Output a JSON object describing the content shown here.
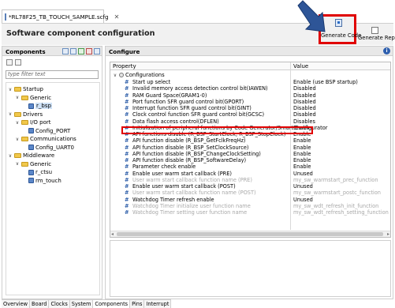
{
  "file_tab": {
    "label": "*RL78F25_TB_TOUCH_SAMPLE.scfg",
    "close": "✕"
  },
  "header": {
    "title": "Software component configuration"
  },
  "buttons": {
    "generate_code": "Generate Code",
    "generate_report": "Generate Report"
  },
  "components_panel": {
    "title": "Components",
    "filter_placeholder": "type filter text",
    "tree": [
      {
        "label": "Startup",
        "kind": "folder",
        "depth": 0,
        "expanded": true
      },
      {
        "label": "Generic",
        "kind": "folder",
        "depth": 1,
        "expanded": true
      },
      {
        "label": "r_bsp",
        "kind": "component",
        "depth": 2,
        "selected": true
      },
      {
        "label": "Drivers",
        "kind": "folder",
        "depth": 0,
        "expanded": true
      },
      {
        "label": "I/O port",
        "kind": "folder",
        "depth": 1,
        "expanded": true
      },
      {
        "label": "Config_PORT",
        "kind": "component",
        "depth": 2
      },
      {
        "label": "Communications",
        "kind": "folder",
        "depth": 1,
        "expanded": true
      },
      {
        "label": "Config_UART0",
        "kind": "component",
        "depth": 2
      },
      {
        "label": "Middleware",
        "kind": "folder",
        "depth": 0,
        "expanded": true
      },
      {
        "label": "Generic",
        "kind": "folder",
        "depth": 1,
        "expanded": true
      },
      {
        "label": "r_ctsu",
        "kind": "component",
        "depth": 2
      },
      {
        "label": "rm_touch",
        "kind": "component",
        "depth": 2
      }
    ]
  },
  "configure_panel": {
    "title": "Configure",
    "info_icon": "i",
    "col_property": "Property",
    "col_value": "Value",
    "root_label": "Configurations",
    "rows": [
      {
        "property": "Start up select",
        "value": "Enable (use BSP startup)",
        "enabled": true
      },
      {
        "property": "Invalid memory access detection control bit(IAWEN)",
        "value": "Disabled",
        "enabled": true
      },
      {
        "property": "RAM Guard Space(GRAM1-0)",
        "value": "Disabled",
        "enabled": true
      },
      {
        "property": "Port function SFR guard control bit(GPORT)",
        "value": "Disabled",
        "enabled": true
      },
      {
        "property": "Interrupt function SFR guard control bit(GINT)",
        "value": "Disabled",
        "enabled": true
      },
      {
        "property": "Clock control function SFR guard control bit(GCSC)",
        "value": "Disabled",
        "enabled": true
      },
      {
        "property": "Data flash access control(DFLEN)",
        "value": "Disables",
        "enabled": true
      },
      {
        "property": "Initialization of peripheral functions by Code Generator/Smart Configurator",
        "value": "Enable",
        "enabled": true,
        "highlighted": true
      },
      {
        "property": "API functions disable (R_BSP_StartClock, R_BSP_StopClock)",
        "value": "Enable",
        "enabled": true
      },
      {
        "property": "API function disable (R_BSP_GetFclkFreqHz)",
        "value": "Enable",
        "enabled": true
      },
      {
        "property": "API function disable (R_BSP_SetClockSource)",
        "value": "Enable",
        "enabled": true
      },
      {
        "property": "API function disable (R_BSP_ChangeClockSetting)",
        "value": "Enable",
        "enabled": true
      },
      {
        "property": "API function disable (R_BSP_SoftwareDelay)",
        "value": "Enable",
        "enabled": true
      },
      {
        "property": "Parameter check enable",
        "value": "Enable",
        "enabled": true
      },
      {
        "property": "Enable user warm start callback (PRE)",
        "value": "Unused",
        "enabled": true
      },
      {
        "property": "User warm start callback function name (PRE)",
        "value": "my_sw_warmstart_prec_function",
        "enabled": false
      },
      {
        "property": "Enable user warm start callback (POST)",
        "value": "Unused",
        "enabled": true
      },
      {
        "property": "User warm start callback function name (POST)",
        "value": "my_sw_warmstart_postc_function",
        "enabled": false
      },
      {
        "property": "Watchdog Timer refresh enable",
        "value": "Unused",
        "enabled": true
      },
      {
        "property": "Watchdog Timer initialize user function name",
        "value": "my_sw_wdt_refresh_init_function",
        "enabled": false
      },
      {
        "property": "Watchdog Timer setting user function name",
        "value": "my_sw_wdt_refresh_setting_function",
        "enabled": false
      }
    ]
  },
  "bottom_tabs": [
    "Overview",
    "Board",
    "Clocks",
    "System",
    "Components",
    "Pins",
    "Interrupt"
  ],
  "active_bottom_tab": "Components",
  "colors": {
    "highlight": "#e00000",
    "arrow": "#2e5597",
    "hash": "#2b5ca8"
  }
}
